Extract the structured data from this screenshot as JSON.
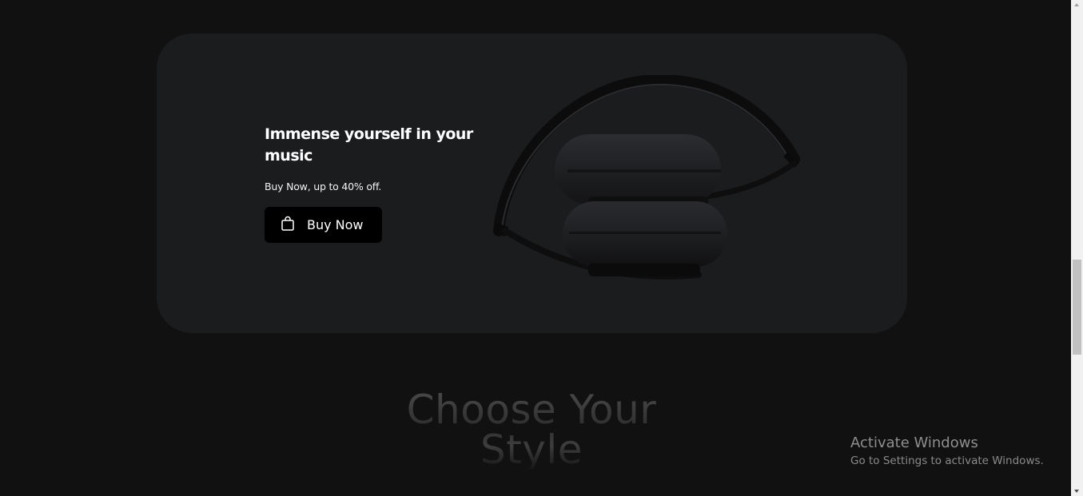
{
  "promo": {
    "title": "Immense yourself in your music",
    "subtitle": "Buy Now, up to 40% off.",
    "button_label": "Buy Now",
    "button_icon": "shopping-bag-icon",
    "product_image": "headphones-image"
  },
  "section": {
    "heading": "Choose Your Style"
  },
  "watermark": {
    "title": "Activate Windows",
    "subtitle": "Go to Settings to activate Windows."
  },
  "colors": {
    "page_background": "#111112",
    "card_background": "#1b1c1e",
    "button_background": "#000000",
    "text_primary": "#ffffff"
  }
}
